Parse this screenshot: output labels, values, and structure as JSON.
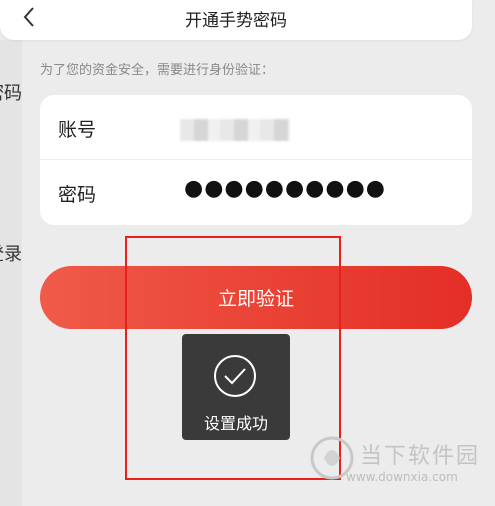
{
  "header": {
    "back_icon": "chevron-left-icon",
    "title": "开通手势密码"
  },
  "side": {
    "fragment1": "密码",
    "fragment2": "登录"
  },
  "form": {
    "hint": "为了您的资金安全，需要进行身份验证：",
    "account_label": "账号",
    "password_label": "密码",
    "password_value": "●●●●●●●●●●"
  },
  "actions": {
    "verify_label": "立即验证"
  },
  "toast": {
    "icon": "check-circle-icon",
    "text": "设置成功"
  },
  "watermark": {
    "brand": "当下软件园",
    "url": "www.downxia.com"
  },
  "colors": {
    "accent": "#e42e26",
    "highlight": "#e8211a"
  }
}
